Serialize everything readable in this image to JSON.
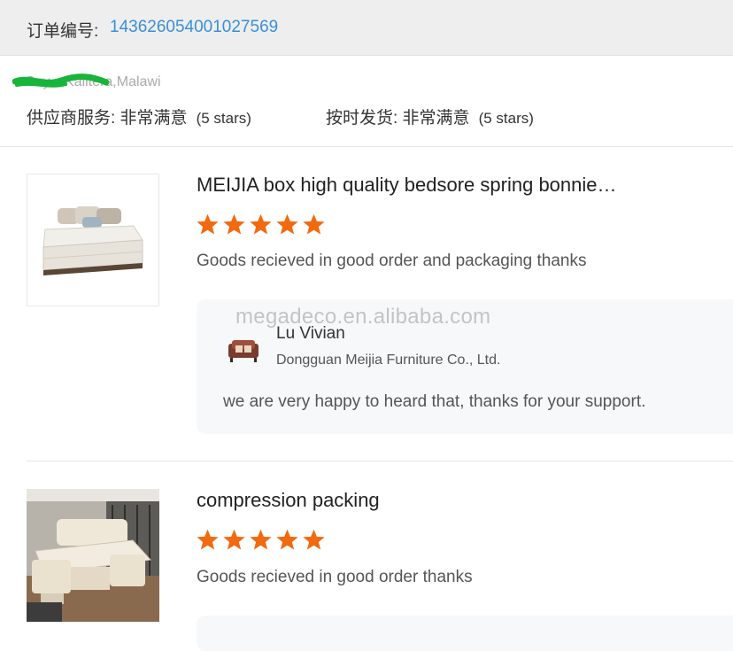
{
  "order": {
    "label": "订单编号: ",
    "number": "143626054001027569"
  },
  "customer": {
    "location": "Cuy... Kalitera,Malawi"
  },
  "ratings": {
    "supplier_service": "供应商服务: 非常满意",
    "supplier_service_stars": "(5 stars)",
    "on_time_delivery": "按时发货: 非常满意",
    "on_time_delivery_stars": "(5 stars)"
  },
  "reviews": [
    {
      "title": "MEIJIA box high quality bedsore spring bonnie…",
      "stars": 5,
      "text": "Goods recieved in good order and packaging thanks",
      "thumbnail_icon": "mattress-image",
      "reply": {
        "watermark": "megadeco.en.alibaba.com",
        "seller_name": "Lu Vivian",
        "seller_company": "Dongguan Meijia Furniture Co., Ltd.",
        "text": "we are very happy to heard that, thanks for your support."
      }
    },
    {
      "title": "compression packing",
      "stars": 5,
      "text": "Goods recieved in good order thanks",
      "thumbnail_icon": "smart-bed-image"
    }
  ],
  "colors": {
    "order_number": "#3a8fd6",
    "star": "#f26a10",
    "header_bg": "#eeeeee",
    "reply_bg": "#f7f8fa"
  }
}
